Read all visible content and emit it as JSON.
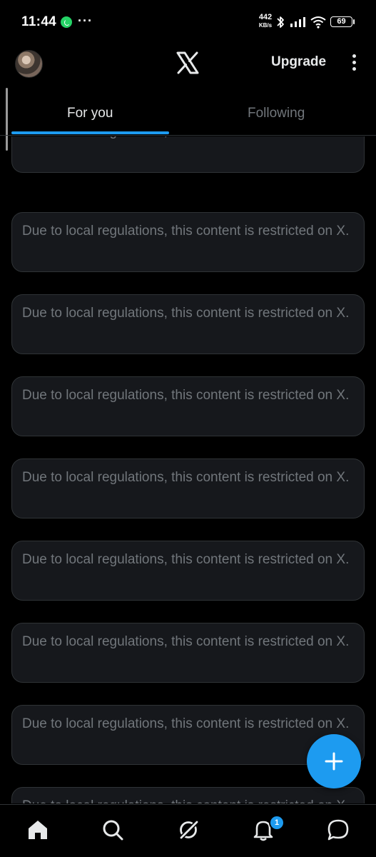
{
  "status_bar": {
    "time": "11:44",
    "net_speed_value": "442",
    "net_speed_unit": "KB/s",
    "battery_level": "69"
  },
  "header": {
    "logo_icon": "x-logo-icon",
    "upgrade_label": "Upgrade",
    "more_icon": "more-vertical-icon"
  },
  "tabs": [
    {
      "label": "For you",
      "active": true
    },
    {
      "label": "Following",
      "active": false
    }
  ],
  "feed": {
    "items": [
      "Due to local regulations, this content is restricted on X.",
      "Due to local regulations, this content is restricted on X.",
      "Due to local regulations, this content is restricted on X.",
      "Due to local regulations, this content is restricted on X.",
      "Due to local regulations, this content is restricted on X.",
      "Due to local regulations, this content is restricted on X.",
      "Due to local regulations, this content is restricted on X.",
      "Due to local regulations, this content is restricted on X.",
      "Due to local regulations, this content is restricted on X."
    ]
  },
  "compose": {
    "icon": "plus-icon"
  },
  "bottom_nav": {
    "items": [
      "home-icon",
      "search-icon",
      "grok-icon",
      "bell-icon",
      "messages-icon"
    ],
    "notifications_badge": "1"
  },
  "colors": {
    "accent": "#1d9bf0",
    "background": "#000000",
    "card": "#16181c",
    "muted_text": "#71767b"
  }
}
